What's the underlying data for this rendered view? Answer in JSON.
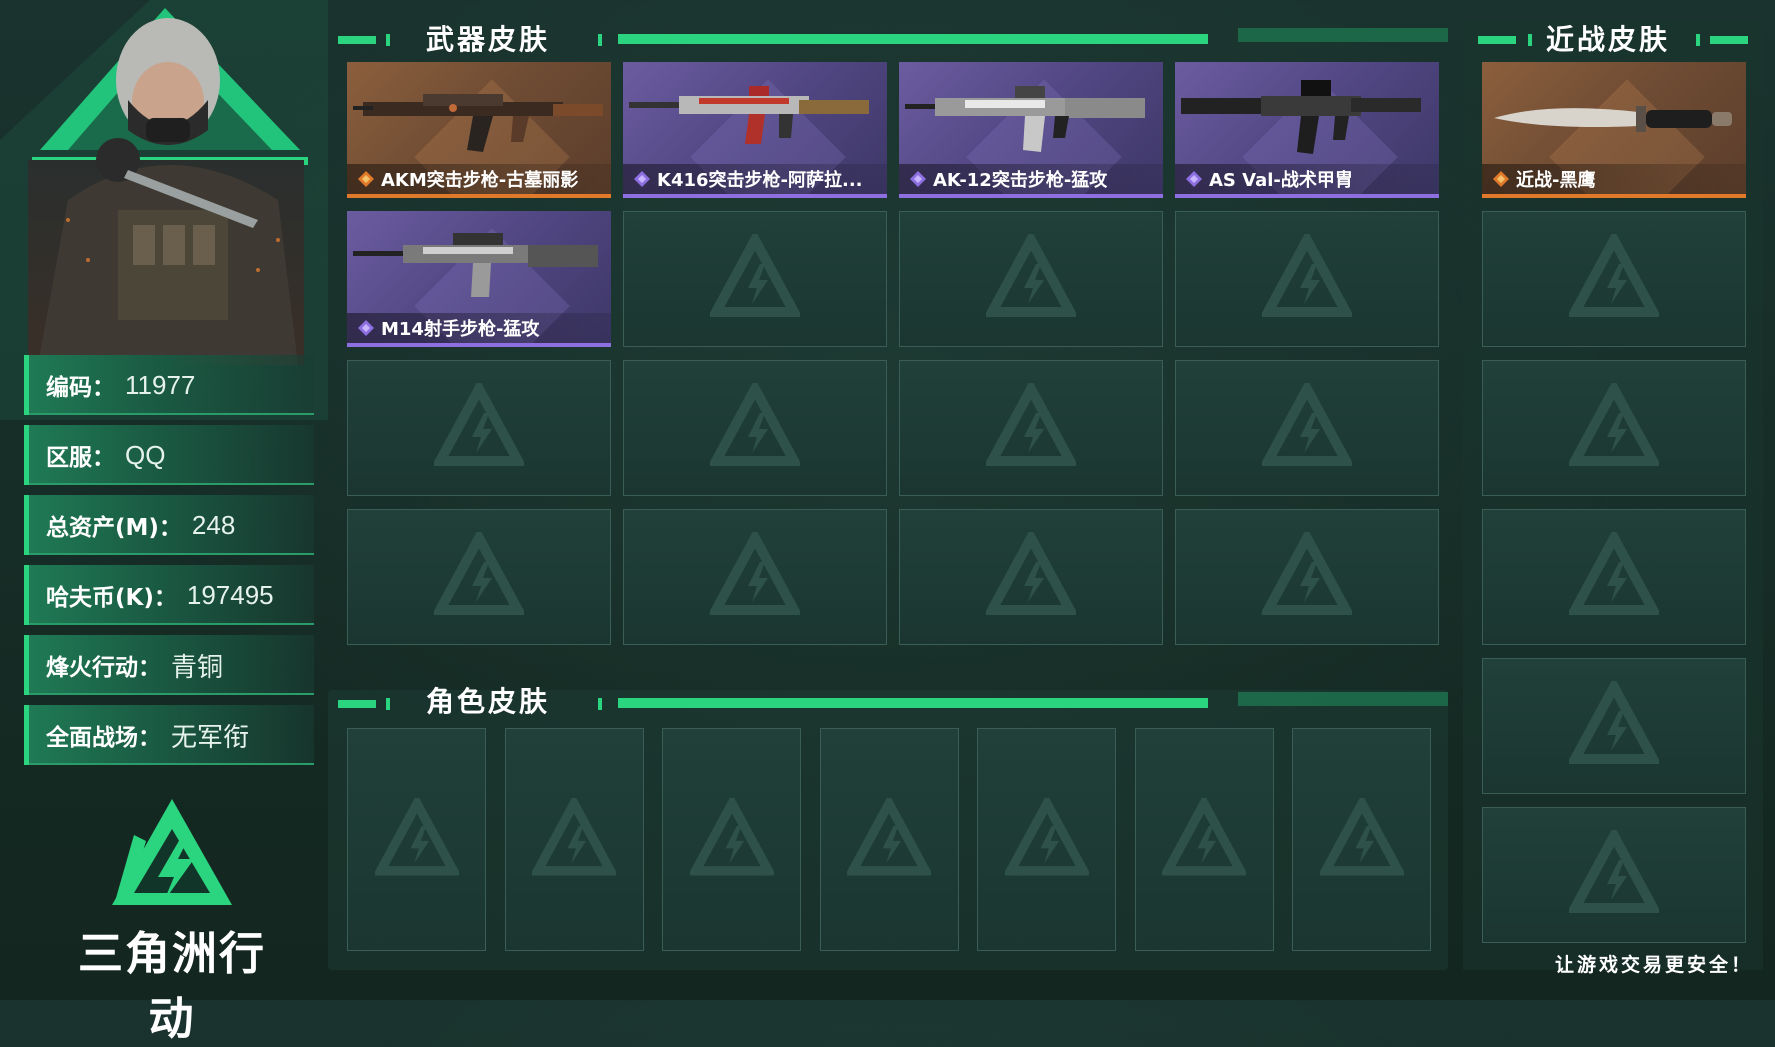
{
  "profile": {
    "rows": [
      {
        "label": "编码",
        "value": "11977"
      },
      {
        "label": "区服",
        "value": "QQ"
      },
      {
        "label": "总资产(M)",
        "value": "248"
      },
      {
        "label": "哈夫币(K)",
        "value": "197495"
      },
      {
        "label": "烽火行动",
        "value": "青铜"
      },
      {
        "label": "全面战场",
        "value": "无军衔"
      }
    ],
    "colon": "："
  },
  "logo": {
    "text": "三角洲行动"
  },
  "weapon_section": {
    "title": "武器皮肤",
    "skins": [
      {
        "name": "AKM突击步枪-古墓丽影",
        "rarity": "gold"
      },
      {
        "name": "K416突击步枪-阿萨拉...",
        "rarity": "purple"
      },
      {
        "name": "AK-12突击步枪-猛攻",
        "rarity": "purple"
      },
      {
        "name": "AS Val-战术甲胄",
        "rarity": "purple"
      },
      {
        "name": "M14射手步枪-猛攻",
        "rarity": "purple"
      }
    ]
  },
  "character_section": {
    "title": "角色皮肤"
  },
  "melee_section": {
    "title": "近战皮肤",
    "skins": [
      {
        "name": "近战-黑鹰",
        "rarity": "gold"
      }
    ]
  },
  "tagline": "让游戏交易更安全！",
  "colors": {
    "accent": "#2bd47e",
    "gold_rarity": "#e07a2a",
    "purple_rarity": "#8d6fe0",
    "background": "#18302b"
  }
}
